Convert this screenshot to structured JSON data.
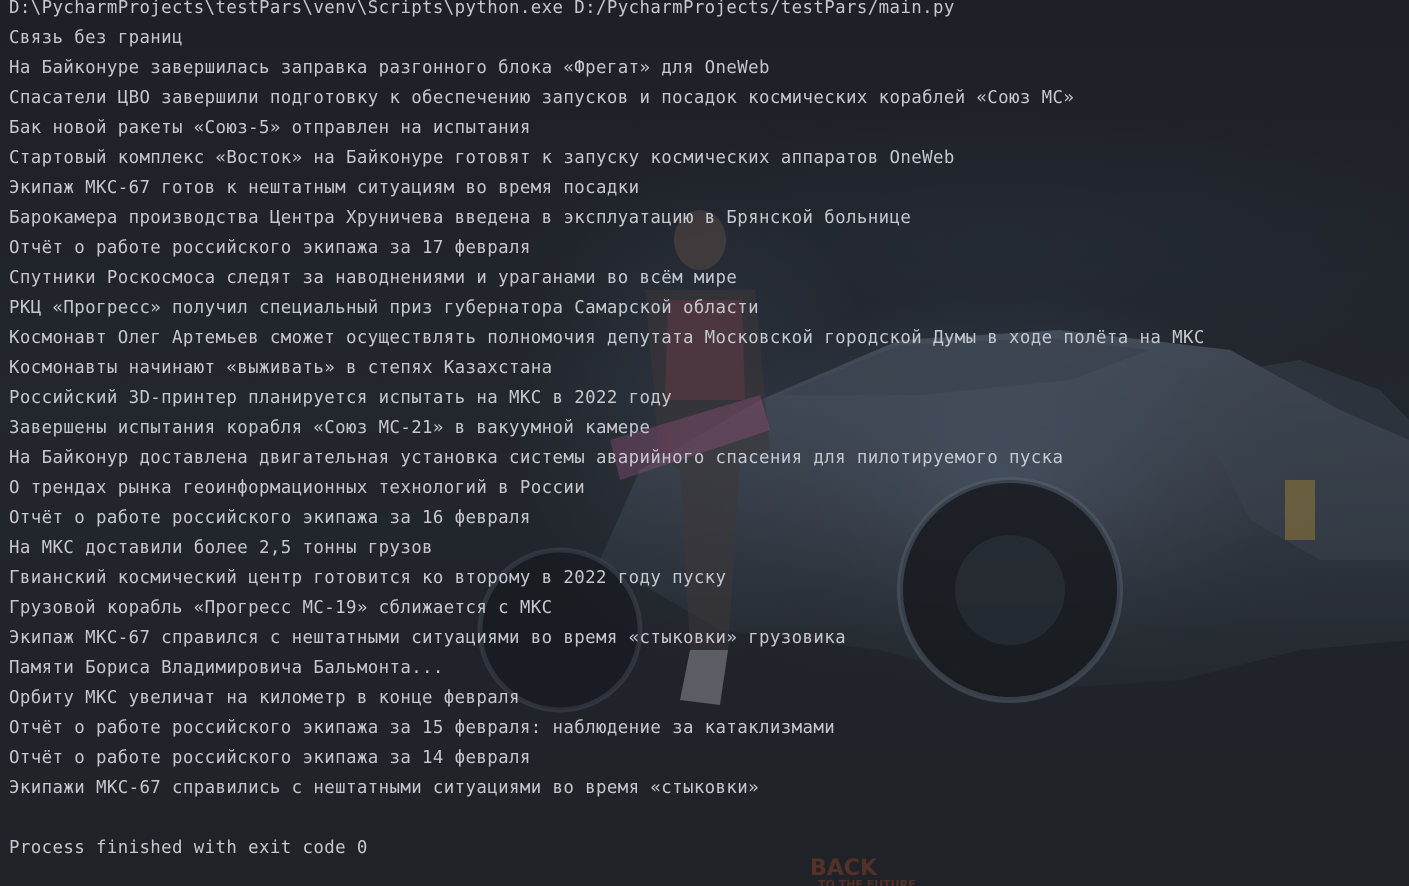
{
  "console": {
    "command": "D:\\PycharmProjects\\testPars\\venv\\Scripts\\python.exe D:/PycharmProjects/testPars/main.py",
    "lines": [
      "Связь без границ",
      "На Байконуре завершилась заправка разгонного блока «Фрегат» для OneWeb",
      "Спасатели ЦВО завершили подготовку к обеспечению запусков и посадок космических кораблей «Союз МС»",
      "Бак новой ракеты «Союз-5» отправлен на испытания",
      "Стартовый комплекс «Восток» на Байконуре готовят к запуску космических аппаратов OneWeb",
      "Экипаж МКС-67 готов к нештатным ситуациям во время посадки",
      "Барокамера производства Центра Хруничева введена в эксплуатацию в Брянской больнице",
      "Отчёт о работе российского экипажа за 17 февраля",
      "Спутники Роскосмоса следят за наводнениями и ураганами во всём мире",
      "РКЦ «Прогресс» получил специальный приз губернатора Самарской области",
      "Космонавт Олег Артемьев сможет осуществлять полномочия депутата Московской городской Думы в ходе полёта на МКС",
      "Космонавты начинают «выживать» в степях Казахстана",
      "Российский 3D-принтер планируется испытать на МКС в 2022 году",
      "Завершены испытания корабля «Союз МС-21» в вакуумной камере",
      "На Байконур доставлена двигательная установка системы аварийного спасения для пилотируемого пуска",
      "О трендах рынка геоинформационных технологий в России",
      "Отчёт о работе российского экипажа за 16 февраля",
      "На МКС доставили более 2,5 тонны грузов",
      "Гвианский космический центр готовится ко второму в 2022 году пуску",
      "Грузовой корабль «Прогресс МС-19» сближается с МКС",
      "Экипаж МКС-67 справился с нештатными ситуациями во время «стыковки» грузовика",
      "Памяти Бориса Владимировича Бальмонта...",
      "Орбиту МКС увеличат на километр в конце февраля",
      "Отчёт о работе российского экипажа за 15 февраля: наблюдение за катаклизмами",
      "Отчёт о работе российского экипажа за 14 февраля",
      "Экипажи МКС-67 справились с нештатными ситуациями во время «стыковки»"
    ],
    "exit_message": "Process finished with exit code 0"
  },
  "background": {
    "watermark_text": "BACK TO THE FUTURE"
  },
  "colors": {
    "text": "#c5c9cf",
    "background": "#1f2227"
  }
}
